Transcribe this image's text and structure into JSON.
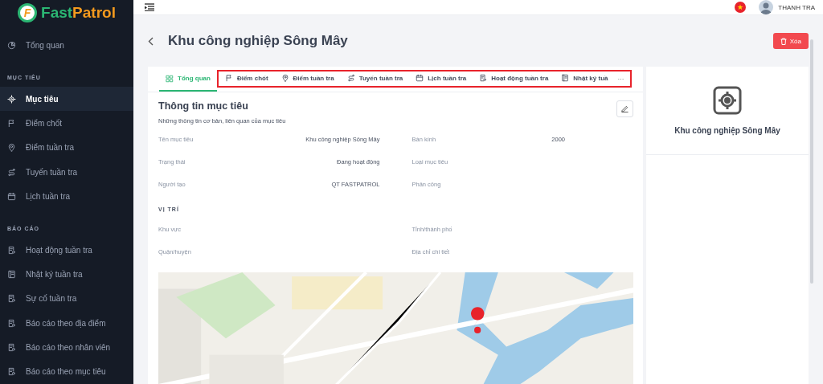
{
  "sidebar": {
    "logo": {
      "name_part1": "Fast",
      "name_part2": "Patrol",
      "letter": "F"
    },
    "top_item": {
      "label": "Tổng quan",
      "selected": false
    },
    "sections": [
      {
        "title": "MỤC TIÊU",
        "items": [
          {
            "label": "Mục tiêu",
            "selected": true
          },
          {
            "label": "Điểm chốt",
            "selected": false
          },
          {
            "label": "Điểm tuần tra",
            "selected": false
          },
          {
            "label": "Tuyến tuần tra",
            "selected": false
          },
          {
            "label": "Lịch tuần tra",
            "selected": false
          }
        ]
      },
      {
        "title": "BÁO CÁO",
        "items": [
          {
            "label": "Hoạt động tuần tra",
            "selected": false
          },
          {
            "label": "Nhật ký tuần tra",
            "selected": false
          },
          {
            "label": "Sự cố tuần tra",
            "selected": false
          },
          {
            "label": "Báo cáo theo địa điểm",
            "selected": false
          },
          {
            "label": "Báo cáo theo nhân viên",
            "selected": false
          },
          {
            "label": "Báo cáo theo mục tiêu",
            "selected": false
          }
        ]
      }
    ]
  },
  "topbar": {
    "user": "THANH TRA"
  },
  "page": {
    "title": "Khu công nghiệp Sông Mây",
    "delete_button": "Xóa"
  },
  "tabs": {
    "items": [
      {
        "label": "Tổng quan",
        "selected": true
      },
      {
        "label": "Điểm chốt",
        "selected": false
      },
      {
        "label": "Điểm tuần tra",
        "selected": false
      },
      {
        "label": "Tuyến tuần tra",
        "selected": false
      },
      {
        "label": "Lịch tuần tra",
        "selected": false
      },
      {
        "label": "Hoạt động tuần tra",
        "selected": false
      },
      {
        "label": "Nhật ký tuầ",
        "selected": false
      }
    ],
    "more": "···"
  },
  "info": {
    "title": "Thông tin mục tiêu",
    "subtitle": "Những thông tin cơ bản, liên quan của mục tiêu",
    "fields": [
      {
        "label": "Tên mục tiêu",
        "value": "Khu công nghiệp Sông Mây"
      },
      {
        "label": "Bán kính",
        "value": "2000"
      },
      {
        "label": "Trạng thái",
        "value": "Đang hoạt động"
      },
      {
        "label": "Loại mục tiêu"
      },
      {
        "label": "Người tạo",
        "value": "QT FASTPATROL"
      },
      {
        "label": "Phân công"
      }
    ],
    "location_heading": "VỊ TRÍ",
    "location_fields": [
      {
        "label": "Khu vực"
      },
      {
        "label": "Tỉnh/thành phố"
      },
      {
        "label": "Quận/huyện"
      },
      {
        "label": "Địa chỉ chi tiết"
      }
    ]
  },
  "summary": {
    "name": "Khu công nghiệp Sông Mây"
  }
}
